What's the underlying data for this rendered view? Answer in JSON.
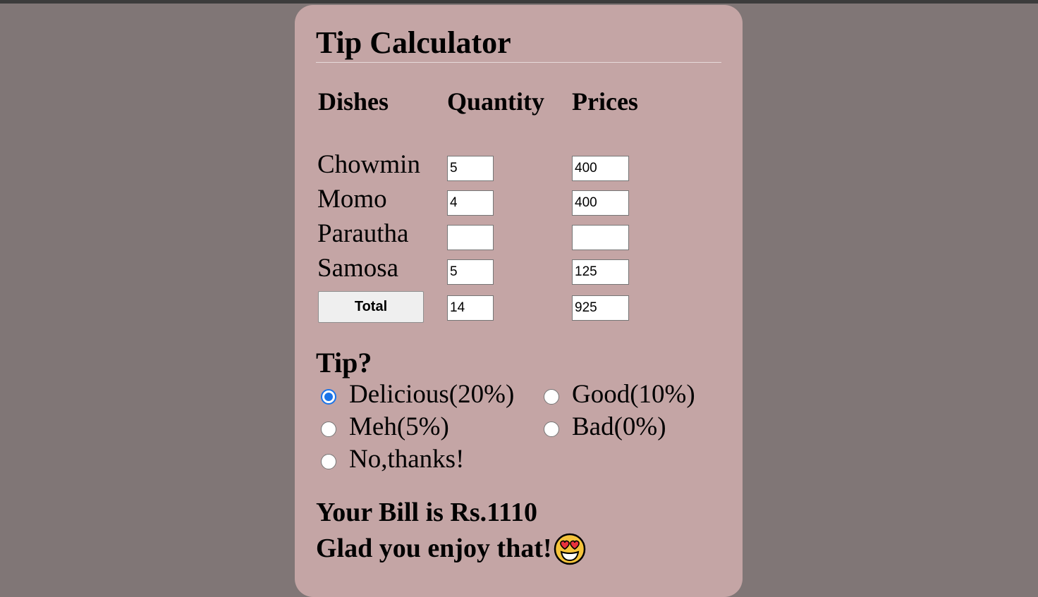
{
  "app": {
    "title": "Tip Calculator"
  },
  "columns": {
    "dishes": "Dishes",
    "quantity": "Quantity",
    "prices": "Prices"
  },
  "dishes": [
    {
      "name": "Chowmin",
      "quantity": "5",
      "price": "400"
    },
    {
      "name": "Momo",
      "quantity": "4",
      "price": "400"
    },
    {
      "name": "Parautha",
      "quantity": "",
      "price": ""
    },
    {
      "name": "Samosa",
      "quantity": "5",
      "price": "125"
    }
  ],
  "total": {
    "button_label": "Total",
    "quantity": "14",
    "price": "925"
  },
  "tip": {
    "heading": "Tip?",
    "options": [
      {
        "label": "Delicious(20%)",
        "checked": true
      },
      {
        "label": "Good(10%)",
        "checked": false
      },
      {
        "label": "Meh(5%)",
        "checked": false
      },
      {
        "label": "Bad(0%)",
        "checked": false
      },
      {
        "label": "No,thanks!",
        "checked": false
      }
    ]
  },
  "result": {
    "bill": "Your Bill is Rs.1110",
    "message": "Glad you enjoy that!",
    "emoji_icon": "heart-eyes-emoji-icon"
  },
  "colors": {
    "background": "#807676",
    "card": "#c4a5a5",
    "accent": "#1a73e8"
  }
}
